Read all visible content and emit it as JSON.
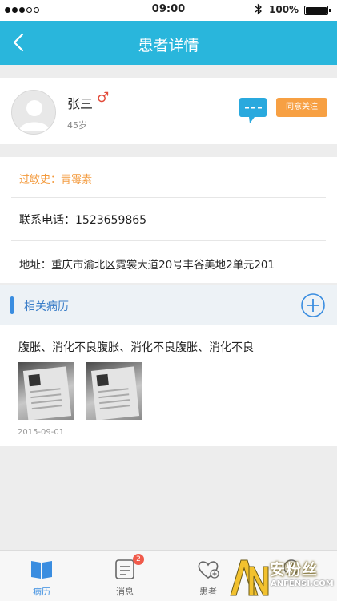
{
  "status_bar": {
    "carrier": "",
    "time": "09:00",
    "bluetooth_icon": "bluetooth-icon",
    "battery_percent": "100%"
  },
  "nav": {
    "title": "患者详情",
    "back_icon": "chevron-left-icon"
  },
  "patient": {
    "name": "张三",
    "gender_symbol": "♂",
    "age": "45岁",
    "avatar_icon": "default-avatar-icon",
    "chat_icon": "chat-bubble-icon",
    "follow_label": "同意关注"
  },
  "info": {
    "allergy": "过敏史：青霉素",
    "phone": "联系电话：1523659865",
    "address": "地址：重庆市渝北区霓裳大道20号丰谷美地2单元201"
  },
  "records": {
    "section_title": "相关病历",
    "add_icon": "plus-circle-icon",
    "items": [
      {
        "description": "腹胀、消化不良腹胀、消化不良腹胀、消化不良",
        "date": "2015-09-01",
        "images": [
          "record-photo-1",
          "record-photo-2"
        ]
      }
    ]
  },
  "tabs": [
    {
      "label": "病历",
      "icon": "book-icon",
      "active": true
    },
    {
      "label": "消息",
      "icon": "message-list-icon",
      "badge": "2"
    },
    {
      "label": "患者",
      "icon": "heart-plus-icon"
    },
    {
      "label": "",
      "icon": "person-icon"
    }
  ],
  "watermark": {
    "logo_text": "AN",
    "cn_text": "安粉丝",
    "en_text": "ANFENSI.COM"
  },
  "colors": {
    "primary": "#29b6dc",
    "accent_orange": "#f7a043",
    "allergy_text": "#f39a3d",
    "link_blue": "#3a8de0",
    "badge_red": "#f05a4a"
  }
}
